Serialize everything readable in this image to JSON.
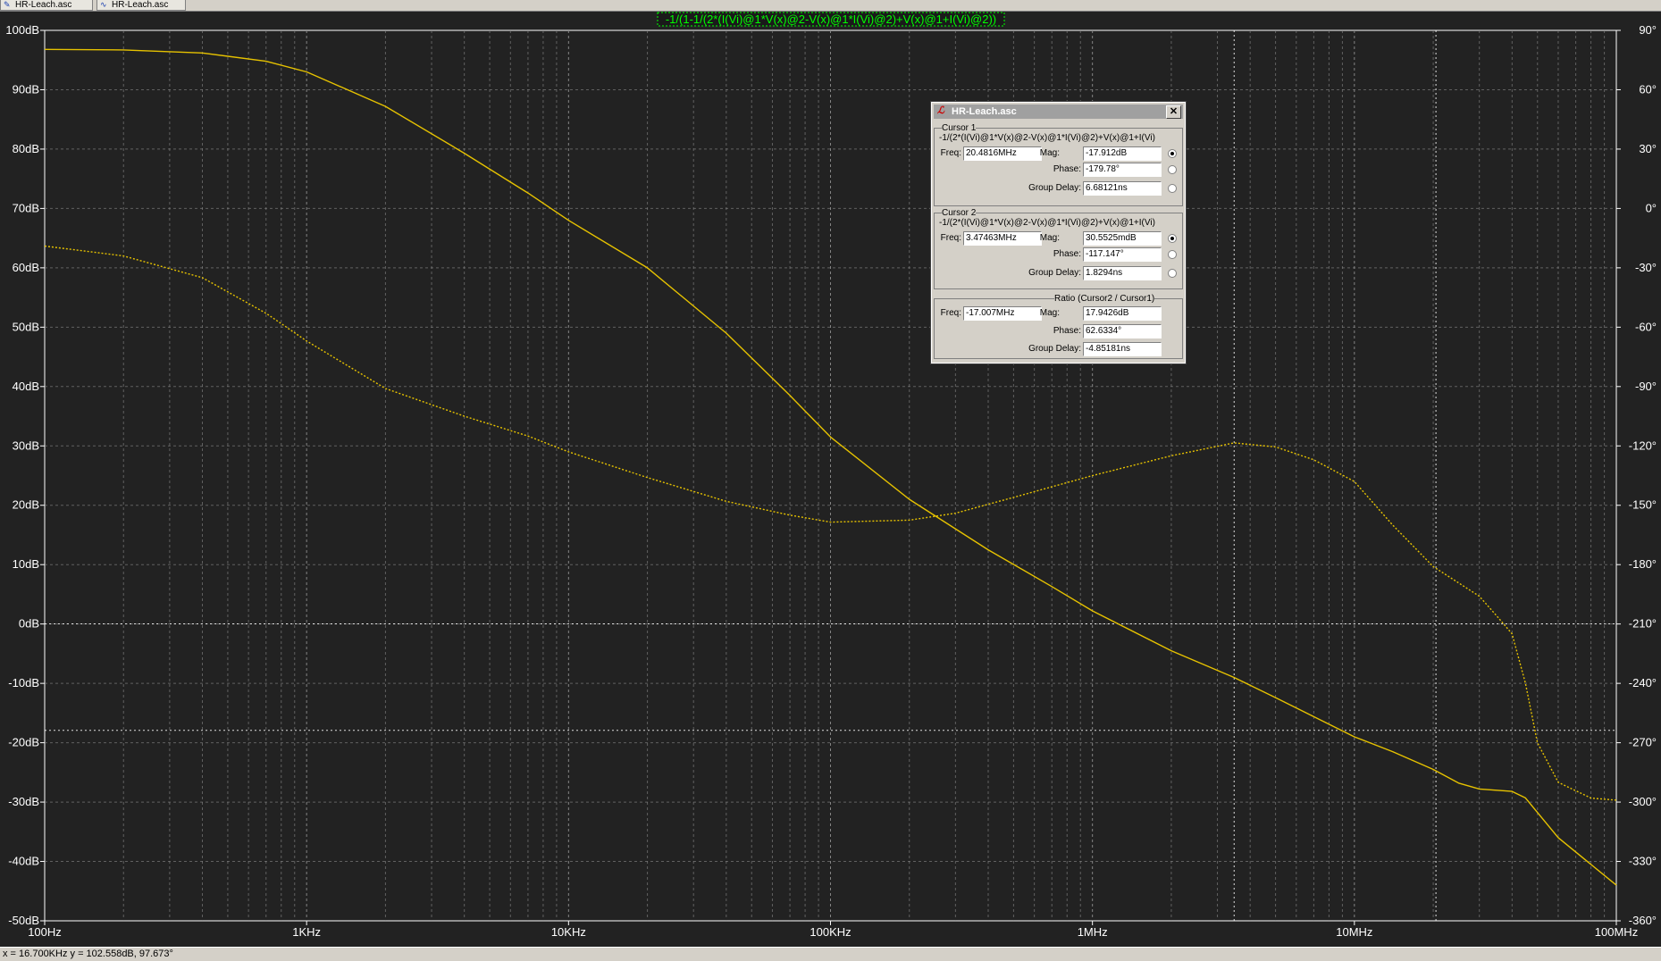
{
  "tabs": [
    {
      "label": "HR-Leach.asc",
      "icon": "schematic-icon"
    },
    {
      "label": "HR-Leach.asc",
      "icon": "waveform-icon"
    }
  ],
  "trace_expression": "-1/(1-1/(2*(I(Vi)@1*V(x)@2-V(x)@1*I(Vi)@2)+V(x)@1+I(Vi)@2))",
  "colors": {
    "background": "#222222",
    "grid": "#8a8a8a",
    "axis_text": "#ffffff",
    "trace": "#e6c200",
    "title_text": "#00ff00",
    "cursor": "#ffffff"
  },
  "chart_data": {
    "type": "line",
    "x_scale": "log",
    "xlim": [
      100,
      100000000
    ],
    "x_ticks": [
      "100Hz",
      "1KHz",
      "10KHz",
      "100KHz",
      "1MHz",
      "10MHz",
      "100MHz"
    ],
    "x_tick_values": [
      100,
      1000,
      10000,
      100000,
      1000000,
      10000000,
      100000000
    ],
    "ylim_left": [
      -50,
      100
    ],
    "y_ticks_left": [
      "100dB",
      "90dB",
      "80dB",
      "70dB",
      "60dB",
      "50dB",
      "40dB",
      "30dB",
      "20dB",
      "10dB",
      "0dB",
      "-10dB",
      "-20dB",
      "-30dB",
      "-40dB",
      "-50dB"
    ],
    "ylim_right": [
      -360,
      90
    ],
    "y_ticks_right": [
      "90°",
      "60°",
      "30°",
      "0°",
      "-30°",
      "-60°",
      "-90°",
      "-120°",
      "-150°",
      "-180°",
      "-210°",
      "-240°",
      "-270°",
      "-300°",
      "-330°",
      "-360°"
    ],
    "grid": true,
    "series": [
      {
        "name": "magnitude",
        "axis": "left",
        "style": "solid",
        "x": [
          100,
          200,
          400,
          700,
          1000,
          2000,
          4000,
          7000,
          10000,
          20000,
          40000,
          70000,
          100000,
          200000,
          400000,
          700000,
          1000000,
          2000000,
          3470000,
          5000000,
          10000000,
          14000000,
          20000000,
          25000000,
          30000000,
          40000000,
          45000000,
          60000000,
          100000000
        ],
        "y": [
          96.8,
          96.7,
          96.2,
          94.8,
          93.0,
          87.2,
          79.3,
          72.6,
          68.0,
          60.0,
          49.0,
          38.5,
          31.5,
          21.0,
          12.5,
          6.3,
          2.2,
          -4.5,
          -9.0,
          -12.4,
          -19.0,
          -21.5,
          -24.5,
          -26.8,
          -27.8,
          -28.2,
          -29.3,
          -36.0,
          -44.0
        ]
      },
      {
        "name": "phase",
        "axis": "right",
        "style": "dotted",
        "x": [
          100,
          200,
          400,
          700,
          1000,
          2000,
          4000,
          7000,
          10000,
          20000,
          40000,
          70000,
          100000,
          200000,
          300000,
          500000,
          1000000,
          2000000,
          3470000,
          5000000,
          7000000,
          10000000,
          14000000,
          20000000,
          30000000,
          35000000,
          40000000,
          45000000,
          50000000,
          60000000,
          80000000,
          100000000
        ],
        "y": [
          -19.0,
          -24.0,
          -35.0,
          -53.0,
          -67.0,
          -91.0,
          -105.0,
          -115.0,
          -123.0,
          -136.0,
          -148.0,
          -155.0,
          -158.5,
          -157.5,
          -154.0,
          -146.0,
          -135.0,
          -125.0,
          -118.5,
          -120.5,
          -127.0,
          -138.0,
          -160.0,
          -181.0,
          -196.0,
          -206.0,
          -215.0,
          -240.0,
          -270.0,
          -290.0,
          -298.0,
          -299.0
        ]
      }
    ]
  },
  "cursor_lines": {
    "cursor1_freq_hz": 20481600,
    "cursor1_mag_db": -17.912,
    "cursor2_freq_hz": 3474630,
    "cursor2_mag_db": 0.0305525
  },
  "dialog": {
    "title": "HR-Leach.asc",
    "close_label": "✕",
    "cursor1": {
      "legend": "Cursor 1",
      "expr": "-1/(2*(I(Vi)@1*V(x)@2-V(x)@1*I(Vi)@2)+V(x)@1+I(Vi)",
      "freq_label": "Freq:",
      "freq": "20.4816MHz",
      "mag_label": "Mag:",
      "mag": "-17.912dB",
      "phase_label": "Phase:",
      "phase": "-179.78°",
      "gd_label": "Group Delay:",
      "gd": "6.68121ns"
    },
    "cursor2": {
      "legend": "Cursor 2",
      "expr": "-1/(2*(I(Vi)@1*V(x)@2-V(x)@1*I(Vi)@2)+V(x)@1+I(Vi)",
      "freq_label": "Freq:",
      "freq": "3.47463MHz",
      "mag_label": "Mag:",
      "mag": "30.5525mdB",
      "phase_label": "Phase:",
      "phase": "-117.147°",
      "gd_label": "Group Delay:",
      "gd": "1.8294ns"
    },
    "ratio": {
      "legend": "Ratio (Cursor2 / Cursor1)",
      "freq_label": "Freq:",
      "freq": "-17.007MHz",
      "mag_label": "Mag:",
      "mag": "17.9426dB",
      "phase_label": "Phase:",
      "phase": "62.6334°",
      "gd_label": "Group Delay:",
      "gd": "-4.85181ns"
    }
  },
  "status": "x = 16.700KHz    y = 102.558dB, 97.673°"
}
